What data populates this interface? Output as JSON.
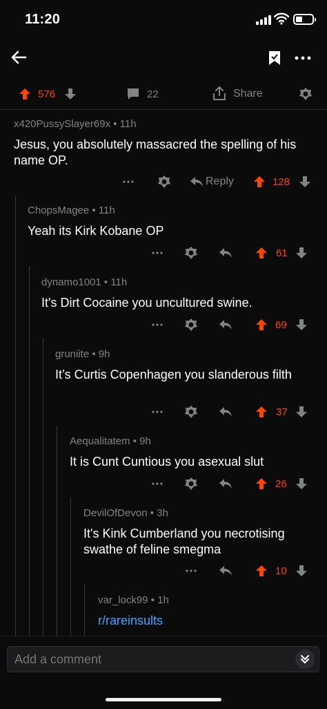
{
  "status": {
    "time": "11:20"
  },
  "post": {
    "score": "576",
    "comments": "22",
    "share_label": "Share"
  },
  "comments": [
    {
      "author": "x420PussySlayer69x",
      "age": "11h",
      "text": "Jesus, you absolutely massacred the spelling of his name OP.",
      "score": "128",
      "reply_label": "Reply"
    },
    {
      "author": "ChopsMagee",
      "age": "11h",
      "text": "Yeah its Kirk Kobane OP",
      "score": "61"
    },
    {
      "author": "dynamo1001",
      "age": "11h",
      "text": "It's Dirt Cocaine you uncultured swine.",
      "score": "69"
    },
    {
      "author": "gruniite",
      "age": "9h",
      "text": "It’s Curtis Copenhagen you slanderous filth",
      "score": "37"
    },
    {
      "author": "Aequalitatem",
      "age": "9h",
      "text": "It is Cunt Cuntious you asexual slut",
      "score": "26"
    },
    {
      "author": "DevilOfDevon",
      "age": "3h",
      "text": "It's Kink Cumberland you necrotising swathe of feline smegma",
      "score": "10"
    },
    {
      "author": "var_lock99",
      "age": "1h",
      "text": "r/rareinsults"
    }
  ],
  "composer": {
    "placeholder": "Add a comment"
  },
  "icons": [
    "back-arrow-icon",
    "bookmark-icon",
    "more-icon",
    "upvote-icon",
    "downvote-icon",
    "comment-icon",
    "share-icon",
    "award-icon",
    "reply-icon",
    "expand-icon"
  ],
  "colors": {
    "accent": "#ff4500",
    "link": "#3ea6ff",
    "background": "#0b0b0c",
    "muted": "#818384"
  }
}
